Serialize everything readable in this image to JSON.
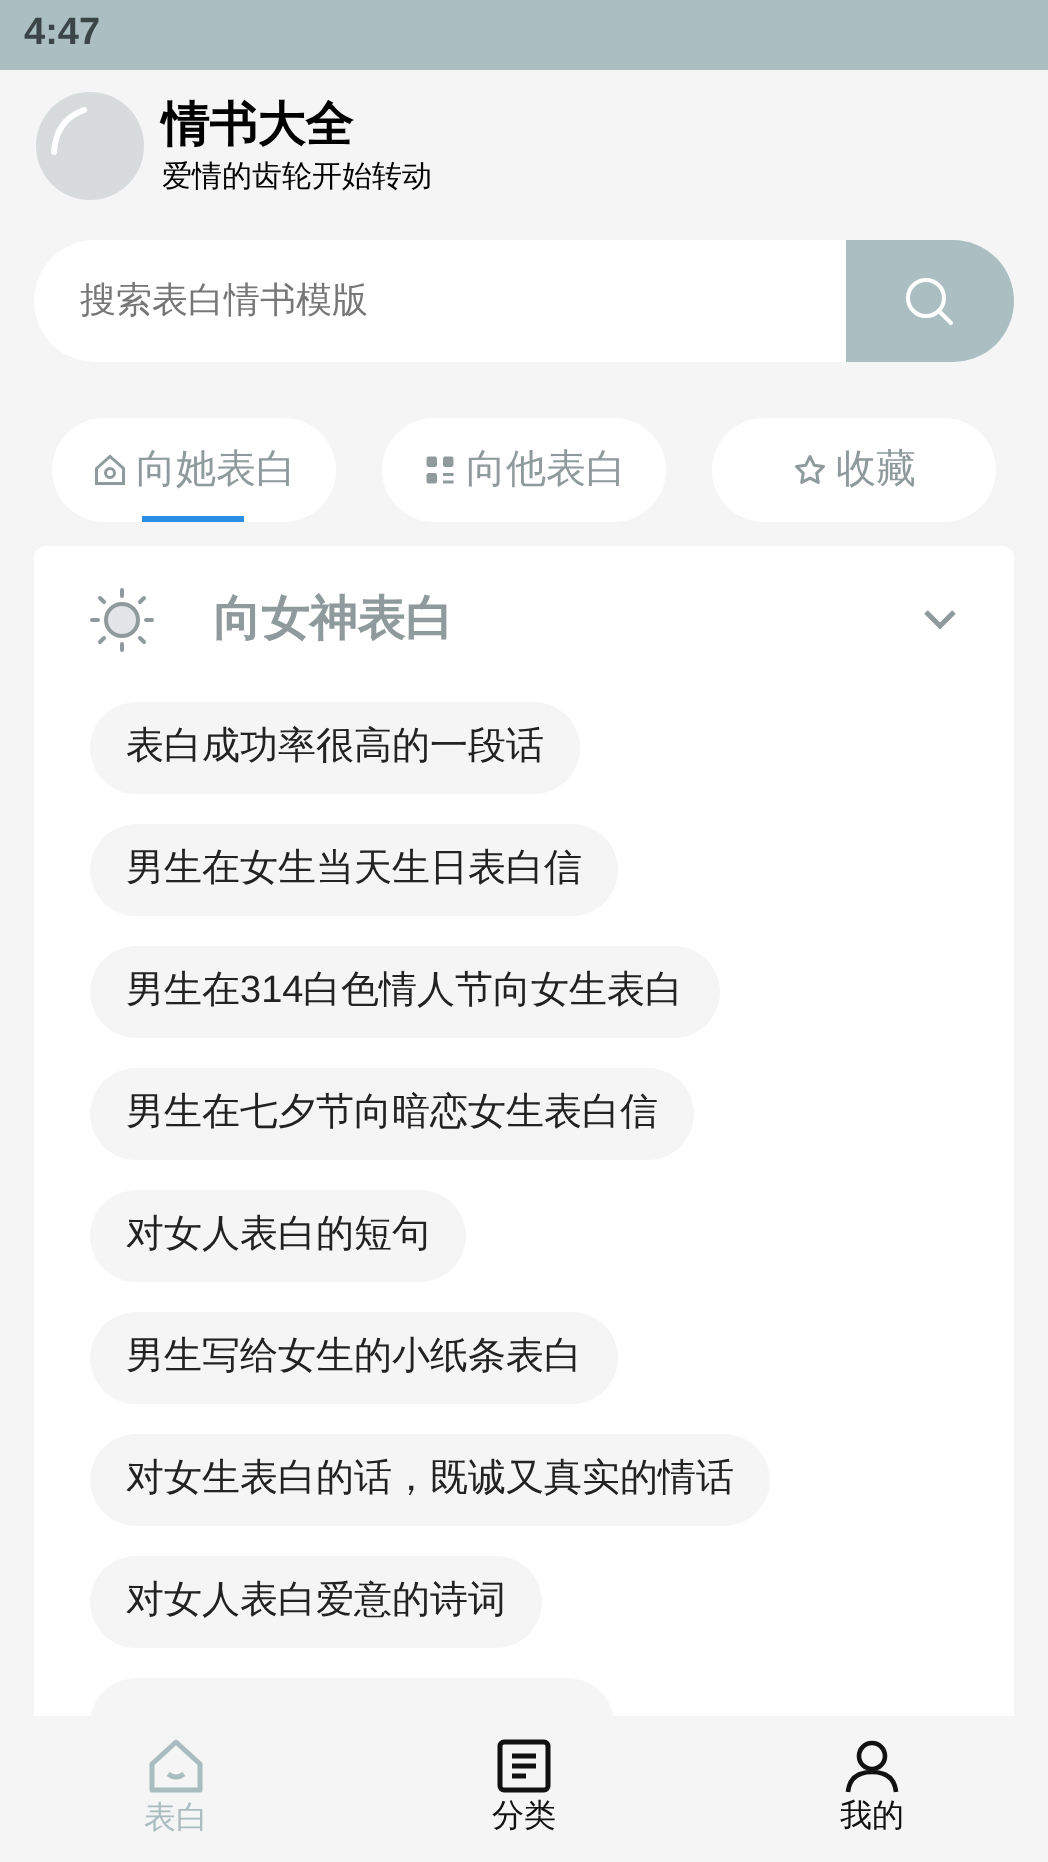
{
  "status_bar": {
    "time": "4:47"
  },
  "header": {
    "title": "情书大全",
    "subtitle": "爱情的齿轮开始转动"
  },
  "search": {
    "placeholder": "搜索表白情书模版"
  },
  "tabs": [
    {
      "label": "向她表白",
      "selected": true
    },
    {
      "label": "向他表白",
      "selected": false
    },
    {
      "label": "收藏",
      "selected": false
    }
  ],
  "section": {
    "title": "向女神表白",
    "expanded": true,
    "items": [
      "表白成功率很高的一段话",
      "男生在女生当天生日表白信",
      "男生在314白色情人节向女生表白",
      "男生在七夕节向暗恋女生表白信",
      "对女人表白的短句",
      "男生写给女生的小纸条表白",
      "对女生表白的话，既诚又真实的情话",
      "对女人表白爱意的诗词"
    ]
  },
  "bottom_nav": [
    {
      "label": "表白",
      "selected": true
    },
    {
      "label": "分类",
      "selected": false
    },
    {
      "label": "我的",
      "selected": false
    }
  ]
}
